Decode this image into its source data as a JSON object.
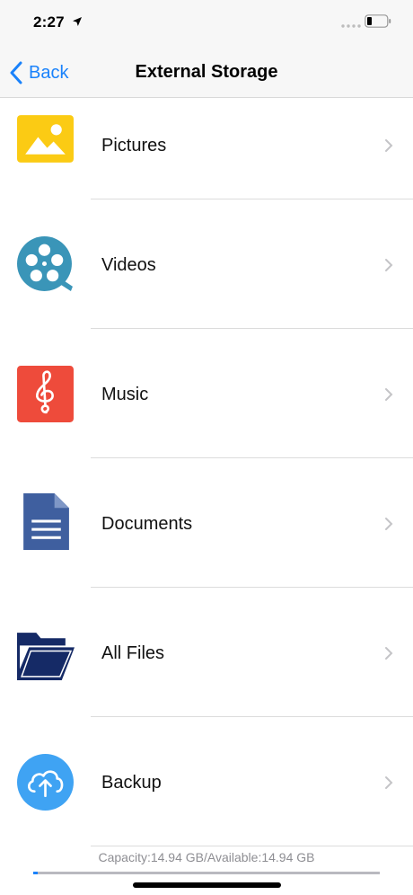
{
  "status_bar": {
    "time": "2:27",
    "icons": [
      "location-arrow-icon",
      "signal-dots-icon",
      "battery-icon"
    ]
  },
  "nav": {
    "back_label": "Back",
    "title": "External Storage",
    "accent_color": "#1a82fb"
  },
  "items": [
    {
      "label": "Pictures",
      "icon": "pictures-icon",
      "color": "#fbcb14"
    },
    {
      "label": "Videos",
      "icon": "videos-icon",
      "color": "#3a95b8"
    },
    {
      "label": "Music",
      "icon": "music-icon",
      "color": "#ee4b3b"
    },
    {
      "label": "Documents",
      "icon": "documents-icon",
      "color": "#3f5f9f"
    },
    {
      "label": "All Files",
      "icon": "folder-icon",
      "color": "#152a66"
    },
    {
      "label": "Backup",
      "icon": "backup-cloud-icon",
      "color": "#3fa3f3"
    }
  ],
  "footer": {
    "capacity_text": "Capacity:14.94 GB/Available:14.94 GB",
    "usage_fraction": 0.012
  }
}
